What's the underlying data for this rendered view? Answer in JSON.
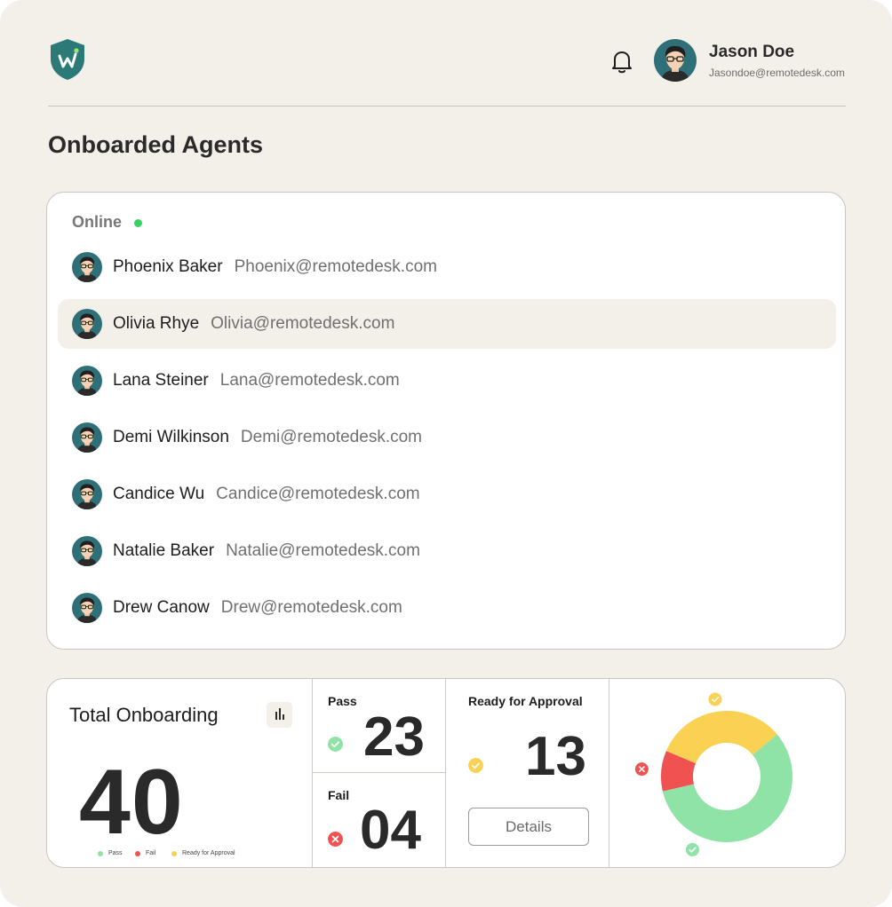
{
  "colors": {
    "background": "#f3efe9",
    "brand": "#2b7a78",
    "online": "#39d163",
    "pass": "#90e3a6",
    "fail": "#f05252",
    "ready": "#fbd154"
  },
  "header": {
    "logo_icon": "shield-w-logo",
    "notification_icon": "bell-icon"
  },
  "user": {
    "name": "Jason Doe",
    "email": "Jasondoe@remotedesk.com"
  },
  "page_title": "Onboarded Agents",
  "agents": {
    "status_label": "Online",
    "items": [
      {
        "name": "Phoenix Baker",
        "email": "Phoenix@remotedesk.com",
        "selected": false
      },
      {
        "name": "Olivia Rhye",
        "email": "Olivia@remotedesk.com",
        "selected": true
      },
      {
        "name": "Lana Steiner",
        "email": "Lana@remotedesk.com",
        "selected": false
      },
      {
        "name": "Demi Wilkinson",
        "email": "Demi@remotedesk.com",
        "selected": false
      },
      {
        "name": "Candice Wu",
        "email": "Candice@remotedesk.com",
        "selected": false
      },
      {
        "name": "Natalie Baker",
        "email": "Natalie@remotedesk.com",
        "selected": false
      },
      {
        "name": "Drew Canow",
        "email": "Drew@remotedesk.com",
        "selected": false
      }
    ]
  },
  "stats": {
    "total_title": "Total Onboarding",
    "total_value": "40",
    "pass_label": "Pass",
    "pass_value": "23",
    "fail_label": "Fail",
    "fail_value": "04",
    "ready_label": "Ready for Approval",
    "ready_value": "13",
    "details_label": "Details"
  },
  "chart_data": {
    "type": "pie",
    "donut": true,
    "categories": [
      "Pass",
      "Fail",
      "Ready for Approval"
    ],
    "values": [
      23,
      4,
      13
    ],
    "colors": [
      "#90e3a6",
      "#f05252",
      "#fbd154"
    ],
    "legend": "bottom"
  }
}
